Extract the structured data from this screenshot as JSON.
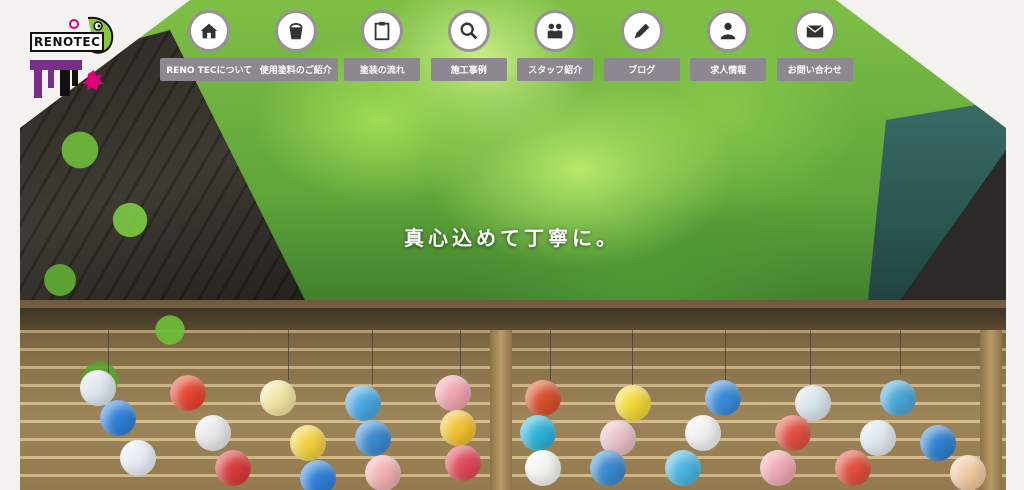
{
  "logo": {
    "text": "RENOTEC"
  },
  "nav": {
    "items": [
      {
        "label": "RENO TECについて",
        "icon": "house-icon"
      },
      {
        "label": "使用塗料のご紹介",
        "icon": "paint-bucket-icon"
      },
      {
        "label": "塗装の流れ",
        "icon": "clipboard-icon"
      },
      {
        "label": "施工事例",
        "icon": "magnifier-icon"
      },
      {
        "label": "スタッフ紹介",
        "icon": "people-icon"
      },
      {
        "label": "ブログ",
        "icon": "pencil-icon"
      },
      {
        "label": "求人情報",
        "icon": "person-icon"
      },
      {
        "label": "お問い合わせ",
        "icon": "envelope-icon"
      }
    ]
  },
  "hero": {
    "tagline": "真心込めて丁寧に。"
  },
  "colors": {
    "nav_label_bg": "#8e8791",
    "nav_circle_border": "#9a8f98",
    "page_bg": "#f4f2ef"
  }
}
